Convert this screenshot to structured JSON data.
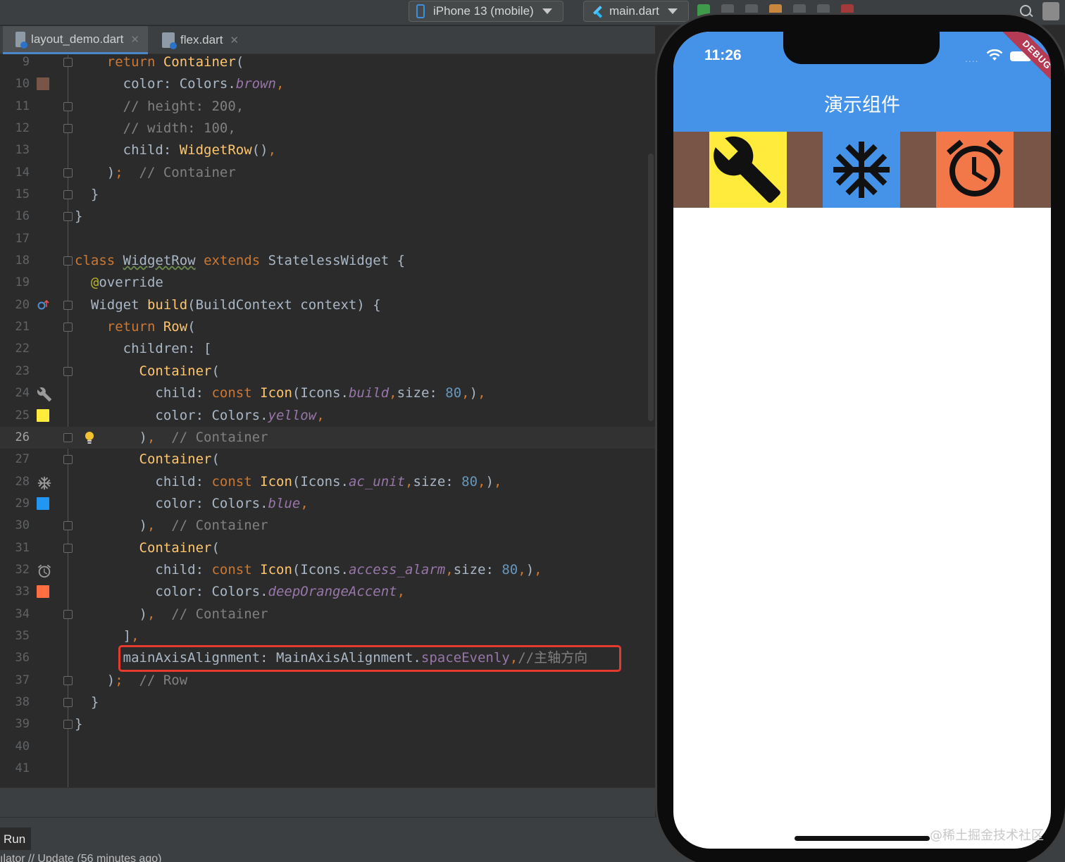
{
  "toolbar": {
    "device": "iPhone 13 (mobile)",
    "run_config": "main.dart"
  },
  "tabs": [
    {
      "label": "layout_demo.dart",
      "active": true
    },
    {
      "label": "flex.dart",
      "active": false
    }
  ],
  "editor": {
    "lines": [
      {
        "n": "9"
      },
      {
        "n": "10"
      },
      {
        "n": "11"
      },
      {
        "n": "12"
      },
      {
        "n": "13"
      },
      {
        "n": "14"
      },
      {
        "n": "15"
      },
      {
        "n": "16"
      },
      {
        "n": "17"
      },
      {
        "n": "18"
      },
      {
        "n": "19"
      },
      {
        "n": "20"
      },
      {
        "n": "21"
      },
      {
        "n": "22"
      },
      {
        "n": "23"
      },
      {
        "n": "24"
      },
      {
        "n": "25"
      },
      {
        "n": "26"
      },
      {
        "n": "27"
      },
      {
        "n": "28"
      },
      {
        "n": "29"
      },
      {
        "n": "30"
      },
      {
        "n": "31"
      },
      {
        "n": "32"
      },
      {
        "n": "33"
      },
      {
        "n": "34"
      },
      {
        "n": "35"
      },
      {
        "n": "36"
      },
      {
        "n": "37"
      },
      {
        "n": "38"
      },
      {
        "n": "39"
      },
      {
        "n": "40"
      },
      {
        "n": "41"
      }
    ],
    "current_line": "26",
    "swatch_colors": {
      "brown": "#795548",
      "yellow": "#ffeb3b",
      "blue": "#2196f3",
      "deep_orange_accent": "#ff6e40"
    },
    "gutter_icons": [
      "swatch-brown",
      "override-marker-icon",
      "wrench-icon",
      "swatch-yellow",
      "lightbulb-icon",
      "snowflake-icon",
      "swatch-blue",
      "alarm-clock-icon",
      "swatch-deep-orange"
    ]
  },
  "run_panel": {
    "tab_label": "Run",
    "status": "ılator // Update     (56 minutes ago)"
  },
  "phone": {
    "time": "11:26",
    "status_dots": "....",
    "debug_banner": "DEBUG",
    "app_title": "演示组件",
    "appbar_color": "#4593e9",
    "row_background": "#795548",
    "tiles": [
      {
        "icon": "wrench-icon",
        "color": "#ffeb3b"
      },
      {
        "icon": "snowflake-icon",
        "color": "#4593e9"
      },
      {
        "icon": "alarm-clock-icon",
        "color": "#f2784a"
      }
    ]
  },
  "watermark": "@稀土掘金技术社区"
}
